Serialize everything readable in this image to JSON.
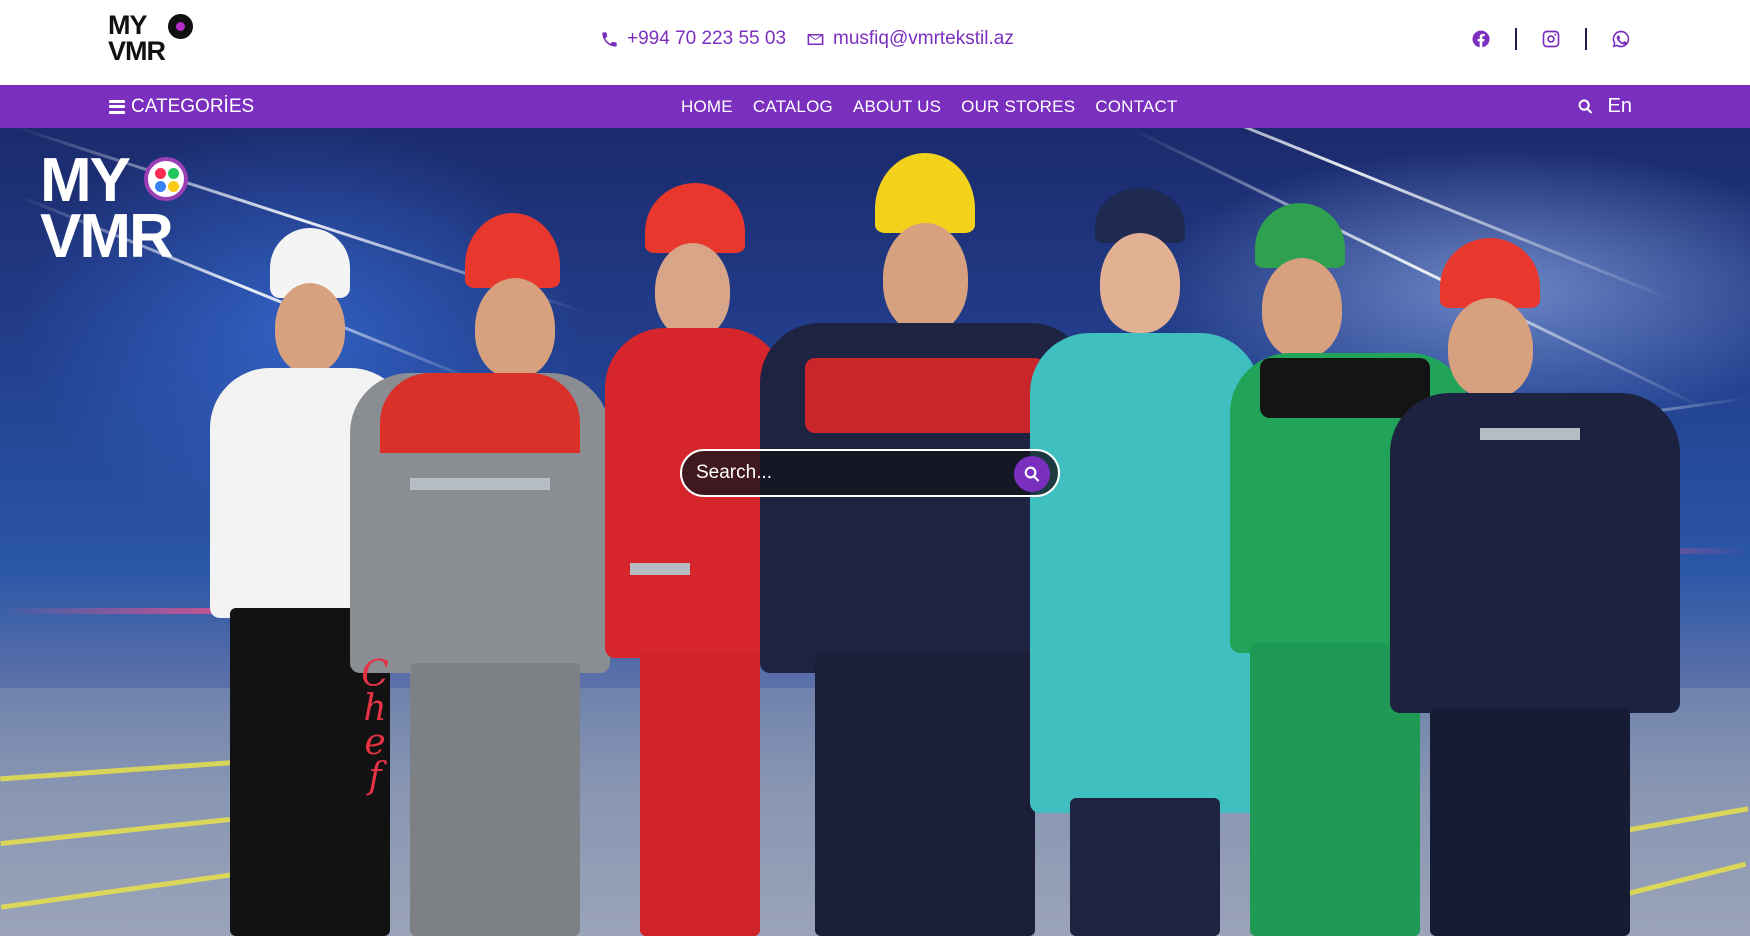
{
  "brand": {
    "logo_line1": "MY",
    "logo_line2": "VMR"
  },
  "contact": {
    "phone": "+994 70 223 55 03",
    "email": "musfiq@vmrtekstil.az"
  },
  "socials": [
    {
      "name": "facebook-icon"
    },
    {
      "name": "instagram-icon"
    },
    {
      "name": "whatsapp-icon"
    }
  ],
  "nav": {
    "categories_label": "CATEGORİES",
    "links": [
      "HOME",
      "CATALOG",
      "ABOUT US",
      "OUR STORES",
      "CONTACT"
    ],
    "language": "En"
  },
  "hero": {
    "logo_line1": "MY",
    "logo_line2": "VMR",
    "search_placeholder": "Search...",
    "apron_text": "Chef"
  },
  "colors": {
    "accent": "#7b2fbf",
    "white": "#ffffff"
  }
}
